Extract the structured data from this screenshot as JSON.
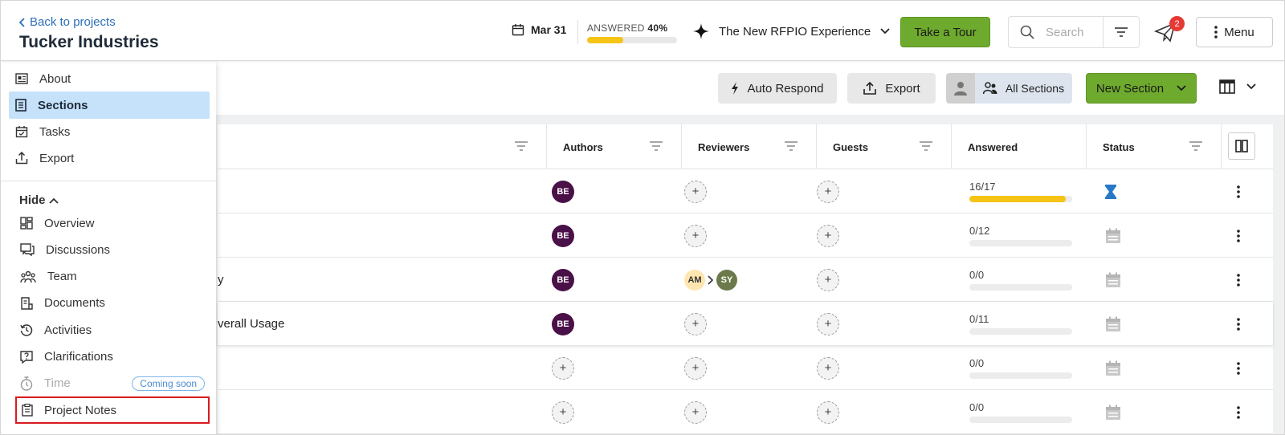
{
  "header": {
    "back_link": "Back to projects",
    "project_title": "Tucker Industries",
    "due_date": "Mar 31",
    "answered_label": "ANSWERED",
    "answered_percent": "40%",
    "answered_fraction": 0.4,
    "experience_label": "The New RFPIO Experience",
    "tour_button": "Take a Tour",
    "search_placeholder": "Search",
    "notification_count": "2",
    "menu_label": "Menu"
  },
  "toolbar": {
    "auto_respond": "Auto Respond",
    "export": "Export",
    "all_sections": "All Sections",
    "new_section": "New Section"
  },
  "sidebar": {
    "items": [
      {
        "label": "About",
        "icon": "about-icon"
      },
      {
        "label": "Sections",
        "icon": "sections-icon",
        "active": true
      },
      {
        "label": "Tasks",
        "icon": "tasks-icon"
      },
      {
        "label": "Export",
        "icon": "export-icon"
      }
    ],
    "hide_label": "Hide",
    "sub_items": [
      {
        "label": "Overview",
        "icon": "overview-icon"
      },
      {
        "label": "Discussions",
        "icon": "discussions-icon"
      },
      {
        "label": "Team",
        "icon": "team-icon"
      },
      {
        "label": "Documents",
        "icon": "documents-icon"
      },
      {
        "label": "Activities",
        "icon": "activities-icon"
      },
      {
        "label": "Clarifications",
        "icon": "clarifications-icon"
      },
      {
        "label": "Time",
        "icon": "timer-icon",
        "badge": "Coming soon"
      },
      {
        "label": "Project Notes",
        "icon": "notes-icon"
      }
    ]
  },
  "table": {
    "columns": [
      "Authors",
      "Reviewers",
      "Guests",
      "Answered",
      "Status"
    ],
    "rows": [
      {
        "name": "",
        "author": "BE",
        "reviewers": [],
        "answered": "16/17",
        "fraction": 0.94,
        "status": "in-progress-icon"
      },
      {
        "name": "",
        "author": "BE",
        "reviewers": [],
        "answered": "0/12",
        "fraction": 0,
        "status": "calendar-icon"
      },
      {
        "name": "y",
        "author": "BE",
        "reviewers": [
          "AM",
          "SY"
        ],
        "answered": "0/0",
        "fraction": 0,
        "status": "calendar-icon"
      },
      {
        "name": "verall Usage",
        "author": "BE",
        "reviewers": [],
        "answered": "0/11",
        "fraction": 0,
        "status": "calendar-icon"
      },
      {
        "name": "",
        "author": "",
        "reviewers": [],
        "answered": "0/0",
        "fraction": 0,
        "status": "calendar-icon"
      },
      {
        "name": "",
        "author": "",
        "reviewers": [],
        "answered": "0/0",
        "fraction": 0,
        "status": "calendar-icon"
      }
    ]
  },
  "colors": {
    "brand_green": "#6eaa2d",
    "active_blue": "#c6e2fb",
    "progress_yellow": "#f5c416",
    "author_avatar": "#4a1048",
    "highlight_red": "#d81b20"
  }
}
